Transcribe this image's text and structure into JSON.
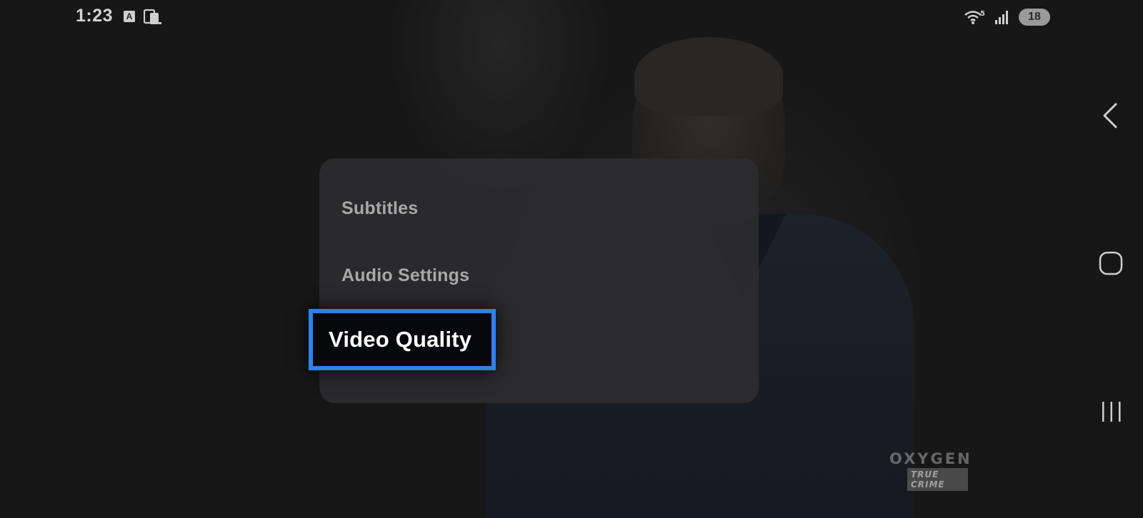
{
  "status_bar": {
    "time": "1:23",
    "icons": [
      "accessibility-a-icon",
      "cast-phone-icon",
      "wifi-icon",
      "signal-icon"
    ],
    "wifi_badge": "5",
    "battery": "18"
  },
  "menu": {
    "items": [
      {
        "label": "Subtitles",
        "focused": false
      },
      {
        "label": "Audio Settings",
        "focused": false
      },
      {
        "label": "Video Quality",
        "focused": true
      }
    ]
  },
  "watermark": {
    "top": "OXYGEN",
    "bottom": "TRUE CRIME"
  },
  "nav": {
    "icons": [
      "back-icon",
      "home-icon",
      "recents-icon"
    ]
  },
  "colors": {
    "focus_border": "#2f80ed",
    "panel": "#2c2c2e",
    "menu_text": "#a8a8a8",
    "focus_text": "#ffffff"
  }
}
